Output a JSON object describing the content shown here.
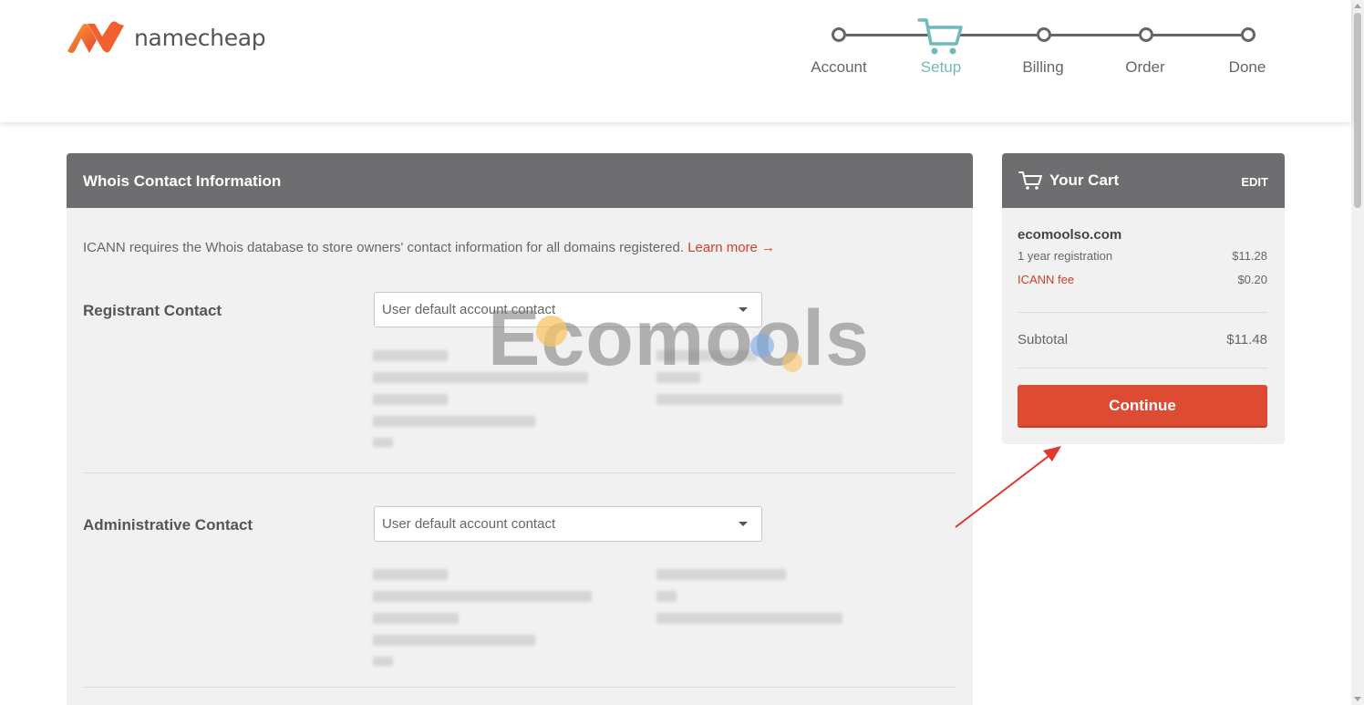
{
  "brand": {
    "name": "namecheap"
  },
  "steps": [
    {
      "label": "Account",
      "state": "done"
    },
    {
      "label": "Setup",
      "state": "active"
    },
    {
      "label": "Billing",
      "state": "pending"
    },
    {
      "label": "Order",
      "state": "pending"
    },
    {
      "label": "Done",
      "state": "pending"
    }
  ],
  "whois": {
    "title": "Whois Contact Information",
    "intro": "ICANN requires the Whois database to store owners' contact information for all domains registered.",
    "learn_more": "Learn more →",
    "registrant": {
      "label": "Registrant Contact",
      "select_value": "User default account contact"
    },
    "administrative": {
      "label": "Administrative Contact",
      "select_value": "User default account contact"
    }
  },
  "watermark": "Ecomools",
  "cart": {
    "title": "Your Cart",
    "edit": "EDIT",
    "domain": "ecomoolso.com",
    "items": [
      {
        "label": "1 year registration",
        "price": "$11.28"
      },
      {
        "label": "ICANN fee",
        "price": "$0.20"
      }
    ],
    "subtotal_label": "Subtotal",
    "subtotal_value": "$11.48",
    "continue_label": "Continue"
  },
  "colors": {
    "brand_orange": "#f26b3a",
    "accent_teal": "#6dbcba",
    "panel_header": "#6e6e70",
    "button_red": "#dd4b33",
    "annotation_arrow": "#e0382e"
  }
}
